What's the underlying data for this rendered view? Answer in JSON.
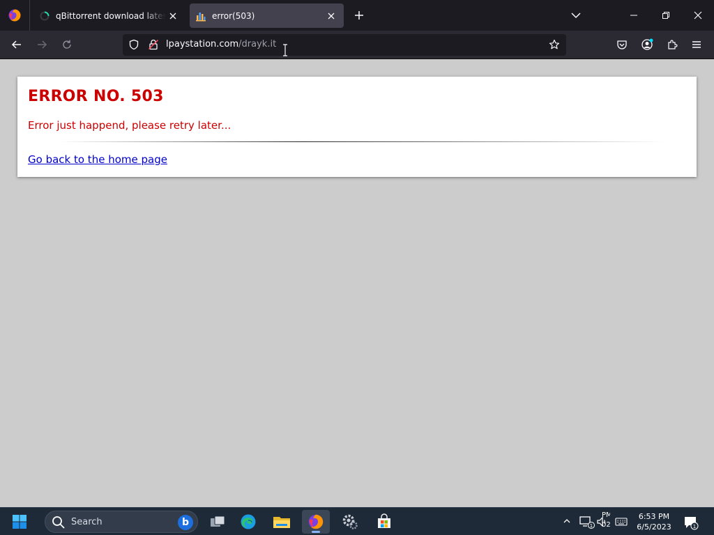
{
  "browser": {
    "tabs": [
      {
        "title": "qBittorrent download latest version",
        "active": false
      },
      {
        "title": "error(503)",
        "active": true
      }
    ],
    "address": {
      "domain": "lpaystation.com",
      "path": "/drayk.it"
    }
  },
  "page": {
    "error_title": "ERROR NO. 503",
    "error_message": "Error just happend, please retry later...",
    "home_link": "Go back to the home page",
    "colors": {
      "error": "#cc0000",
      "link": "#0000cc",
      "background": "#cccccc"
    }
  },
  "taskbar": {
    "search_label": "Search",
    "tray_overflow": "PM 02",
    "clock_time": "6:53 PM",
    "clock_date": "6/5/2023",
    "badge_count": "1",
    "apps": [
      "start-icon",
      "search-input",
      "task-view-icon",
      "edge-icon",
      "file-explorer-icon",
      "firefox-icon",
      "settings-icon",
      "store-icon"
    ]
  }
}
